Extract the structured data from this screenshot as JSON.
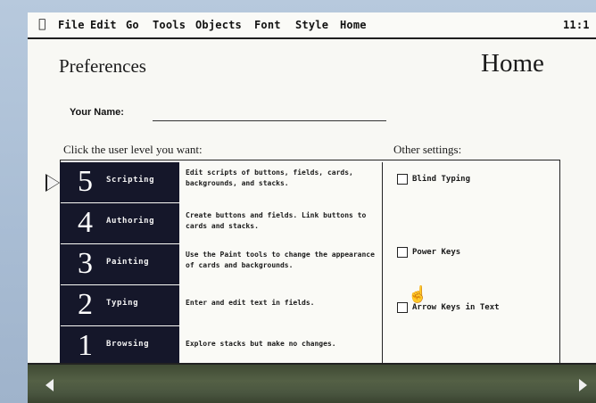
{
  "menubar": {
    "apple_icon": "apple-icon",
    "items": [
      "File",
      "Edit",
      "Go",
      "Tools",
      "Objects",
      "Font",
      "Style",
      "Home"
    ],
    "clock": "11:1"
  },
  "card": {
    "title": "Preferences",
    "stack_name": "Home",
    "your_name_label": "Your Name:",
    "your_name_value": "",
    "levels_heading": "Click the user level you want:",
    "other_heading": "Other settings:"
  },
  "levels": [
    {
      "number": "5",
      "name": "Scripting",
      "description": "Edit scripts of buttons, fields, cards, backgrounds, and stacks."
    },
    {
      "number": "4",
      "name": "Authoring",
      "description": "Create buttons and fields. Link buttons to cards and stacks."
    },
    {
      "number": "3",
      "name": "Painting",
      "description": "Use the Paint tools to change the appearance of cards and backgrounds."
    },
    {
      "number": "2",
      "name": "Typing",
      "description": "Enter and edit text in fields."
    },
    {
      "number": "1",
      "name": "Browsing",
      "description": "Explore stacks but make no changes."
    }
  ],
  "selected_level": "5",
  "settings": {
    "blind_typing": {
      "label": "Blind Typing",
      "checked": false
    },
    "power_keys": {
      "label": "Power Keys",
      "checked": false
    },
    "arrow_keys": {
      "label": "Arrow Keys in Text",
      "checked": false
    }
  },
  "colors": {
    "level_bg": "#15172a",
    "scrollbar": "#4a5640",
    "background": "#a9bdd4"
  }
}
